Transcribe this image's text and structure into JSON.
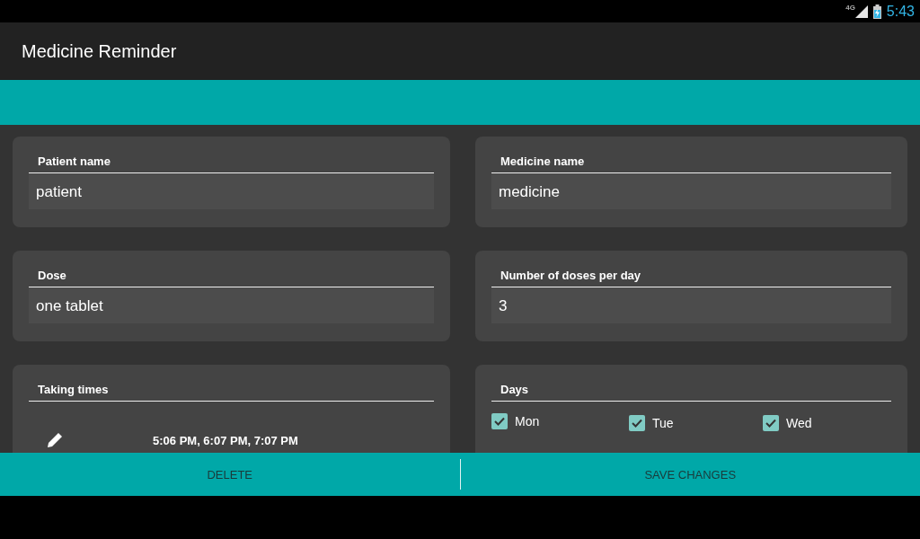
{
  "status_bar": {
    "network": "4G",
    "time": "5:43"
  },
  "app_bar": {
    "title": "Medicine Reminder"
  },
  "fields": [
    {
      "label": "Patient name",
      "value": "patient"
    },
    {
      "label": "Medicine name",
      "value": "medicine"
    },
    {
      "label": "Dose",
      "value": "one tablet"
    },
    {
      "label": "Number of doses per day",
      "value": "3"
    }
  ],
  "taking_times": {
    "label": "Taking times",
    "times": "5:06 PM, 6:07 PM, 7:07 PM"
  },
  "days": {
    "label": "Days",
    "items": [
      {
        "label": "Mon",
        "checked": true
      },
      {
        "label": "Tue",
        "checked": true
      },
      {
        "label": "Wed",
        "checked": true
      }
    ]
  },
  "buttons": [
    {
      "label": "DELETE"
    },
    {
      "label": "SAVE CHANGES"
    }
  ]
}
